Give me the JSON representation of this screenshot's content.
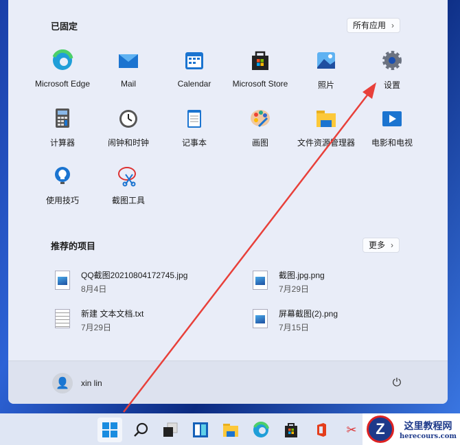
{
  "pinned": {
    "title": "已固定",
    "all_apps": "所有应用",
    "apps": [
      {
        "label": "Microsoft Edge",
        "icon": "edge-icon"
      },
      {
        "label": "Mail",
        "icon": "mail-icon"
      },
      {
        "label": "Calendar",
        "icon": "calendar-icon"
      },
      {
        "label": "Microsoft Store",
        "icon": "store-icon"
      },
      {
        "label": "照片",
        "icon": "photos-icon"
      },
      {
        "label": "设置",
        "icon": "gear-icon"
      },
      {
        "label": "计算器",
        "icon": "calculator-icon"
      },
      {
        "label": "闹钟和时钟",
        "icon": "clock-icon"
      },
      {
        "label": "记事本",
        "icon": "notepad-icon"
      },
      {
        "label": "画图",
        "icon": "paint-icon"
      },
      {
        "label": "文件资源管理器",
        "icon": "folder-icon"
      },
      {
        "label": "电影和电视",
        "icon": "movies-icon"
      },
      {
        "label": "使用技巧",
        "icon": "tips-icon"
      },
      {
        "label": "截图工具",
        "icon": "snipping-icon"
      }
    ]
  },
  "recommended": {
    "title": "推荐的项目",
    "more": "更多",
    "items": [
      {
        "name": "QQ截图20210804172745.jpg",
        "date": "8月4日",
        "type": "img"
      },
      {
        "name": "截图.jpg.png",
        "date": "7月29日",
        "type": "img"
      },
      {
        "name": "新建 文本文档.txt",
        "date": "7月29日",
        "type": "txt"
      },
      {
        "name": "屏幕截图(2).png",
        "date": "7月15日",
        "type": "img"
      }
    ]
  },
  "user": {
    "name": "xin lin"
  },
  "watermark": {
    "title": "这里教程网",
    "url": "herecours.com"
  },
  "colors": {
    "arrow": "#e8403a",
    "accent": "#0067c0"
  }
}
